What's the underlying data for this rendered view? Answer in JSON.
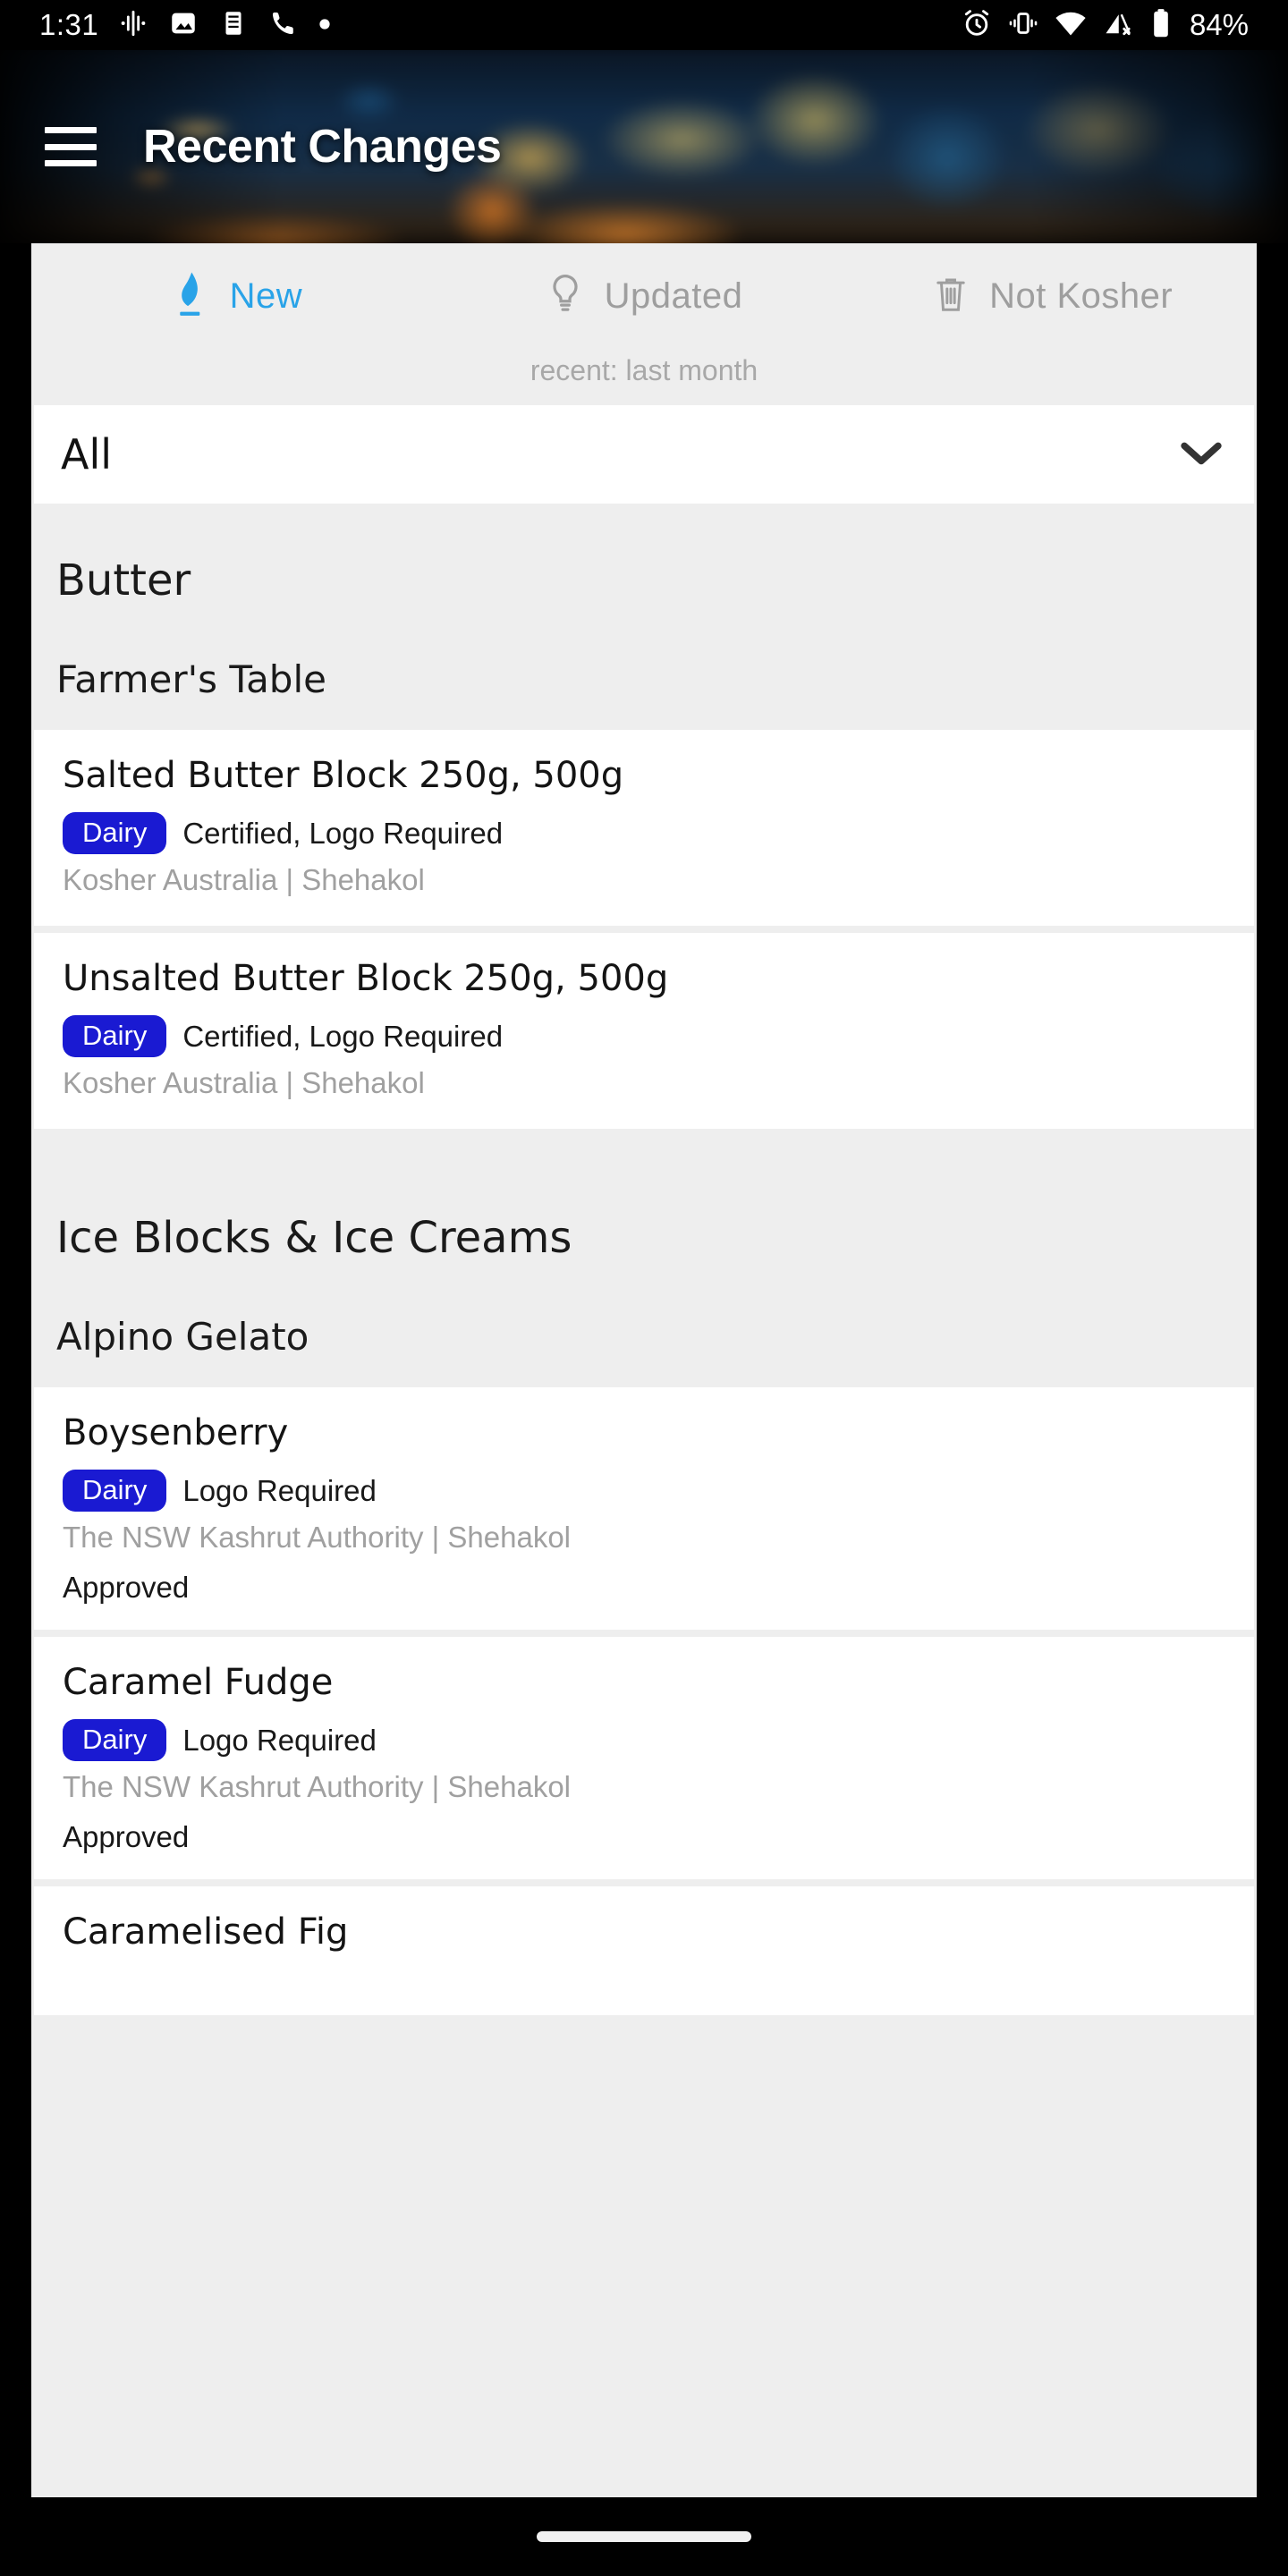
{
  "status_bar": {
    "time": "1:31",
    "battery_text": "84%",
    "left_icons": [
      "music-waveform-icon",
      "image-icon",
      "list-document-icon",
      "phone-icon",
      "dot-icon"
    ],
    "right_icons": [
      "alarm-icon",
      "vibrate-icon",
      "wifi-icon",
      "mobile-signal-off-icon",
      "battery-icon"
    ]
  },
  "appbar": {
    "menu_icon": "hamburger-menu-icon",
    "title": "Recent Changes"
  },
  "tabs": [
    {
      "label": "New",
      "icon": "flame-icon",
      "active": true
    },
    {
      "label": "Updated",
      "icon": "lightbulb-icon",
      "active": false
    },
    {
      "label": "Not Kosher",
      "icon": "trash-icon",
      "active": false
    }
  ],
  "recent_note": "recent: last month",
  "filter_dropdown": {
    "value": "All",
    "chevron": "chevron-down-icon"
  },
  "colors": {
    "accent": "#29a3e8",
    "badge_dairy": "#1a1ad2",
    "panel_bg": "#eeeeee",
    "card_bg": "#ffffff",
    "muted_text": "#a0a0a0"
  },
  "sections": [
    {
      "category": "Butter",
      "brand": "Farmer's Table",
      "products": [
        {
          "name": "Salted Butter Block 250g, 500g",
          "badge": "Dairy",
          "certification": "Certified, Logo Required",
          "authority": "Kosher Australia | Shehakol",
          "status": ""
        },
        {
          "name": "Unsalted Butter Block 250g, 500g",
          "badge": "Dairy",
          "certification": "Certified, Logo Required",
          "authority": "Kosher Australia | Shehakol",
          "status": ""
        }
      ]
    },
    {
      "category": "Ice Blocks & Ice Creams",
      "brand": "Alpino Gelato",
      "products": [
        {
          "name": "Boysenberry",
          "badge": "Dairy",
          "certification": "Logo Required",
          "authority": "The NSW Kashrut Authority | Shehakol",
          "status": "Approved"
        },
        {
          "name": "Caramel Fudge",
          "badge": "Dairy",
          "certification": "Logo Required",
          "authority": "The NSW Kashrut Authority | Shehakol",
          "status": "Approved"
        },
        {
          "name": "Caramelised Fig",
          "badge": "",
          "certification": "",
          "authority": "",
          "status": ""
        }
      ]
    }
  ]
}
